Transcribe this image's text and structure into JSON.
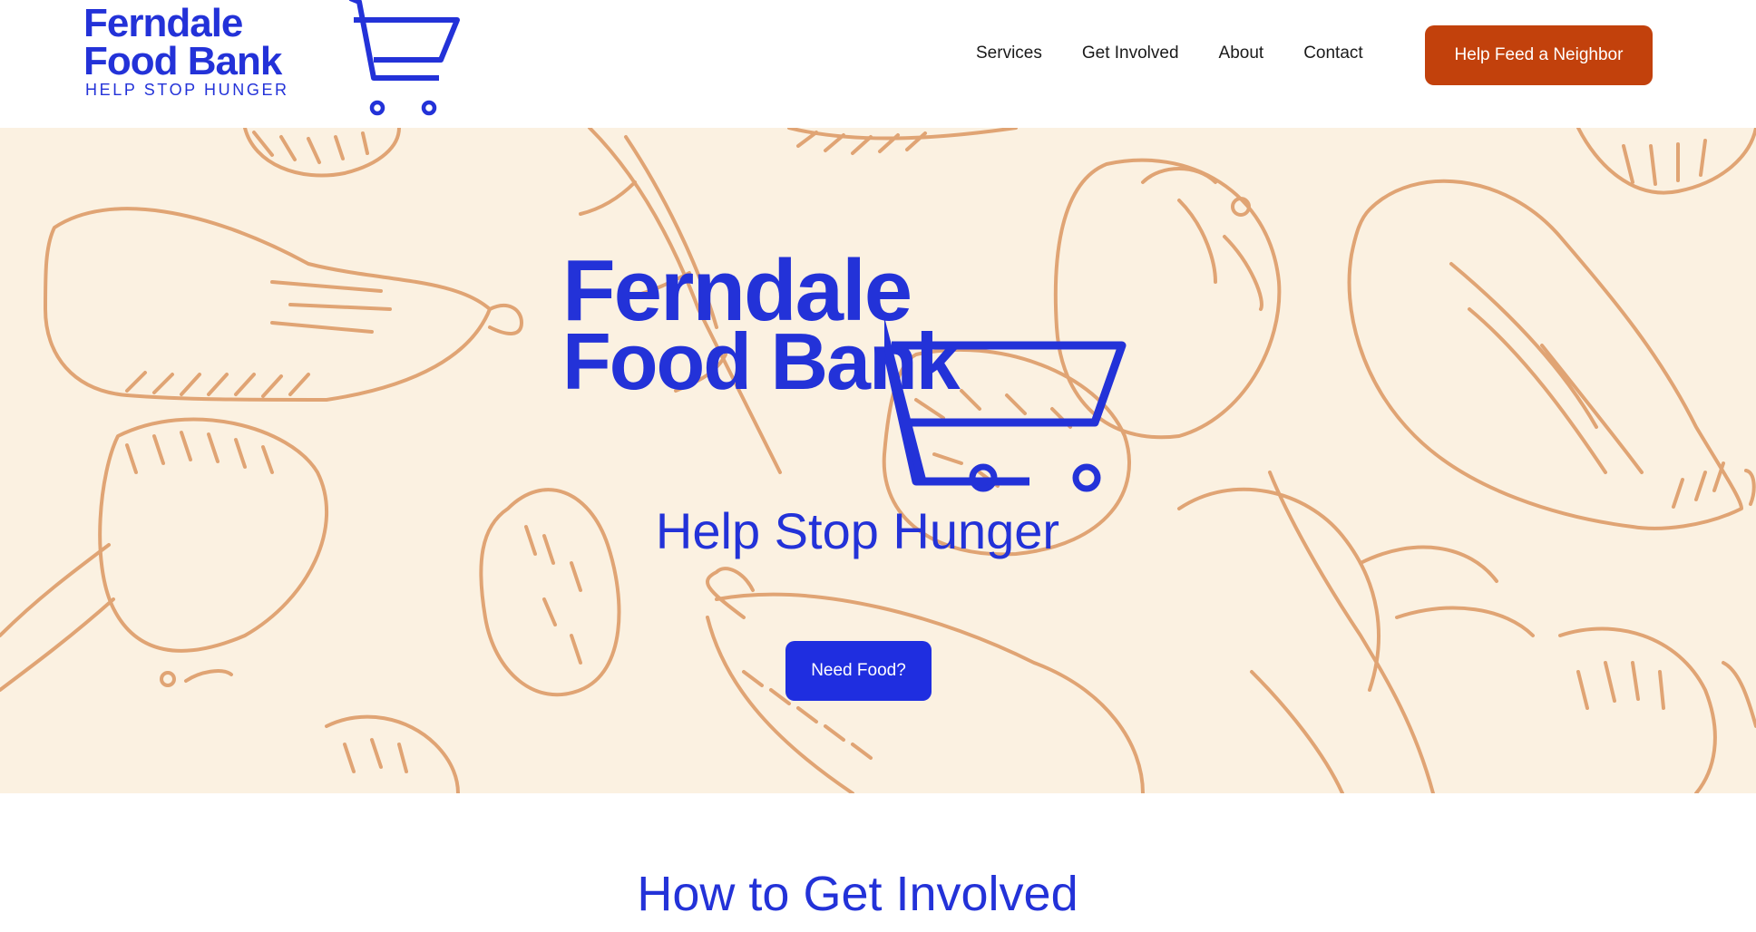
{
  "header": {
    "logo": {
      "line1": "Ferndale",
      "line2": "Food Bank",
      "tagline": "HELP STOP HUNGER"
    },
    "nav": [
      {
        "label": "Services"
      },
      {
        "label": "Get Involved"
      },
      {
        "label": "About"
      },
      {
        "label": "Contact"
      }
    ],
    "cta_label": "Help Feed a Neighbor"
  },
  "hero": {
    "logo": {
      "line1": "Ferndale",
      "line2": "Food Bank"
    },
    "tagline": "Help Stop Hunger",
    "button_label": "Need Food?"
  },
  "section": {
    "title": "How to Get Involved"
  },
  "colors": {
    "brand_blue": "#2332d8",
    "cta_orange": "#c2410c",
    "hero_bg": "#fbf1e1",
    "illustration": "#e0a474"
  },
  "icons": [
    "shopping-cart-icon"
  ]
}
